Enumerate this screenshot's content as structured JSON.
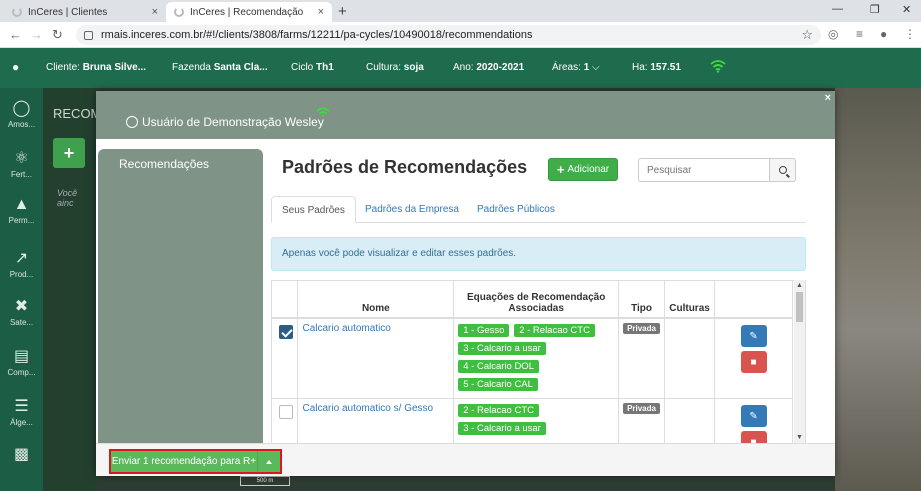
{
  "browser": {
    "tabs": [
      {
        "title": "InCeres | Clientes",
        "close": "×"
      },
      {
        "title": "InCeres | Recomendação",
        "close": "×"
      }
    ],
    "new_tab": "+",
    "url": "rmais.inceres.com.br/#!/clients/3808/farms/12211/pa-cycles/10490018/recommendations",
    "window_controls": {
      "minimize": "—",
      "maximize": "❐",
      "close": "✕"
    },
    "nav": {
      "back": "←",
      "forward": "→",
      "reload": "↻"
    },
    "icons": {
      "star": "☆",
      "ext1": "◎",
      "ext2": "≡",
      "profile": "●",
      "menu": "⋮"
    }
  },
  "appbar": {
    "user_icon": "user-icon",
    "cliente_label": "Cliente:",
    "cliente_value": "Bruna Silve...",
    "fazenda_label": "Fazenda",
    "fazenda_value": "Santa Cla...",
    "ciclo_label": "Ciclo",
    "ciclo_value": "Th1",
    "cultura_label": "Cultura:",
    "cultura_value": "soja",
    "ano_label": "Ano:",
    "ano_value": "2020-2021",
    "areas_label": "Áreas:",
    "areas_value": "1",
    "ha_label": "Ha:",
    "ha_value": "157.51"
  },
  "sidebar": {
    "items": [
      {
        "label": "Amos...",
        "icon": "sampling-icon"
      },
      {
        "label": "Fert...",
        "icon": "fertility-icon"
      },
      {
        "label": "Perm...",
        "icon": "permission-icon"
      },
      {
        "label": "Prod...",
        "icon": "productivity-icon"
      },
      {
        "label": "Sate...",
        "icon": "satellite-icon"
      },
      {
        "label": "Comp...",
        "icon": "compare-icon"
      },
      {
        "label": "Álge...",
        "icon": "layers-icon"
      }
    ]
  },
  "background": {
    "title": "RECOM",
    "empty_text": "Você ainc",
    "scale": "500 m"
  },
  "modal": {
    "close": "×",
    "user_name": "Usuário de Demonstração Wesley",
    "left_label": "Recomendações",
    "page_title": "Padrões de Recomendações",
    "add_label": "Adicionar",
    "search_placeholder": "Pesquisar",
    "tabs": [
      "Seus Padrões",
      "Padrões da Empresa",
      "Padrões Públicos"
    ],
    "alert": "Apenas você pode visualizar e editar esses padrões.",
    "table": {
      "headers": {
        "nome": "Nome",
        "equacoes": "Equações de Recomendação Associadas",
        "tipo": "Tipo",
        "culturas": "Culturas"
      },
      "rows": [
        {
          "checked": true,
          "nome": "Calcario automatico",
          "equacoes": [
            "1 - Gesso",
            "2 - Relacao CTC",
            "3 - Calcario a usar",
            "4 - Calcario DOL",
            "5 - Calcario CAL"
          ],
          "tipo": "Privada",
          "culturas": ""
        },
        {
          "checked": false,
          "nome": "Calcario automatico s/ Gesso",
          "equacoes": [
            "2 - Relacao CTC",
            "3 - Calcario a usar"
          ],
          "tipo": "Privada",
          "culturas": ""
        }
      ]
    },
    "send_label": "Enviar 1 recomendação para R+"
  },
  "colors": {
    "appbar": "#1f6b4d",
    "sidebar": "#1b5e45",
    "modal_header": "#7f9487",
    "success": "#5cb85c",
    "equation_badge": "#3fbf3f",
    "link": "#337ab7",
    "highlight_border": "#e0141c"
  }
}
